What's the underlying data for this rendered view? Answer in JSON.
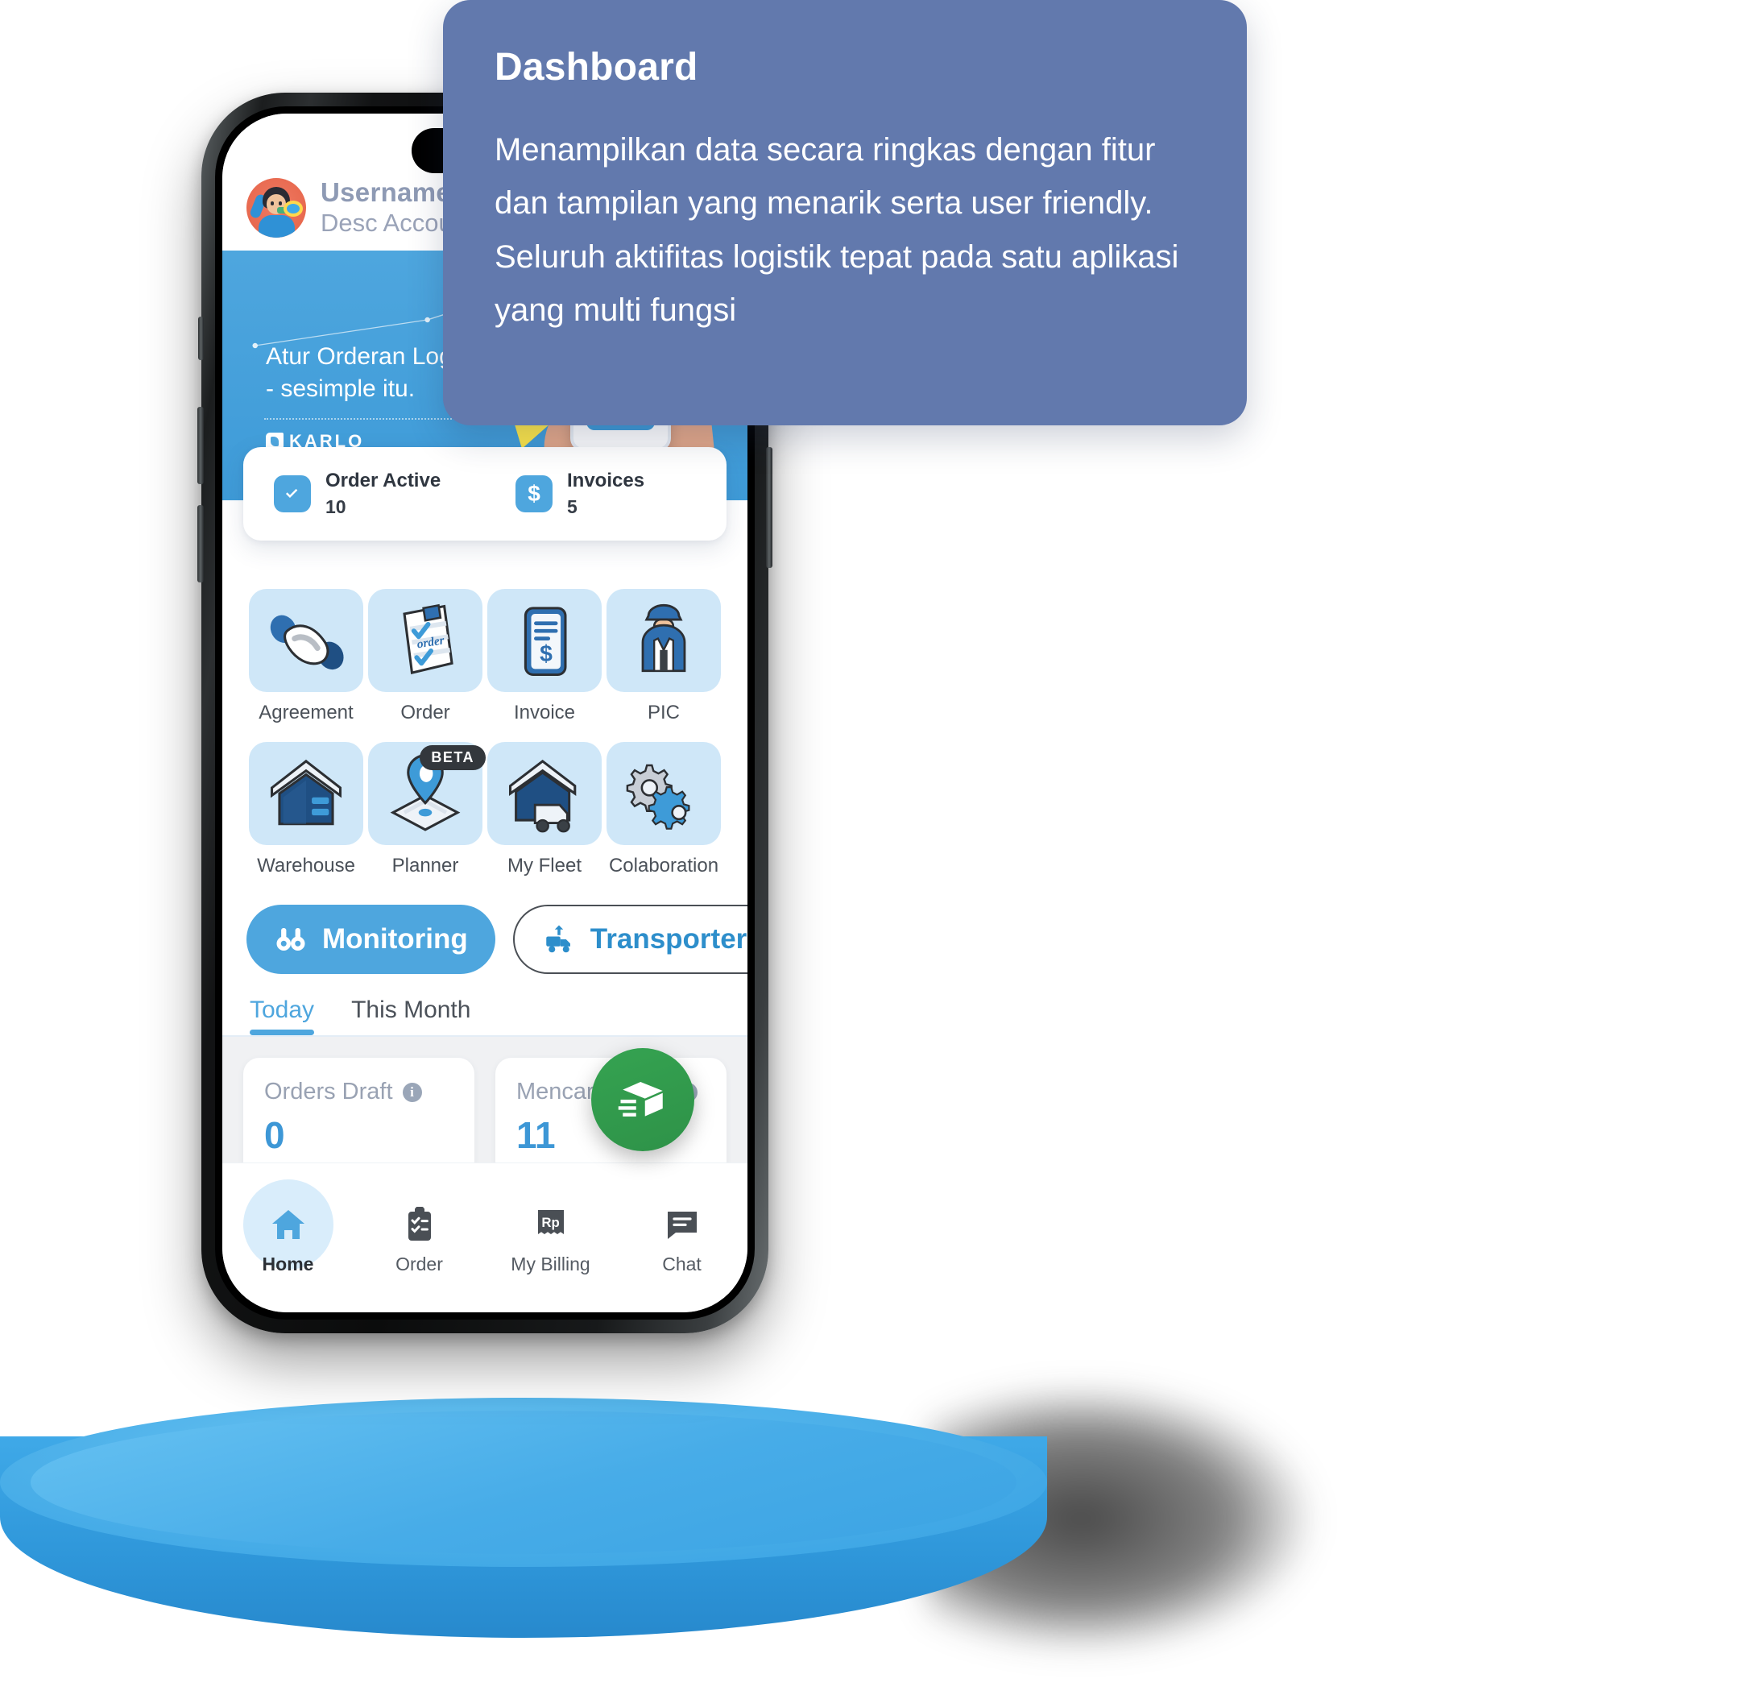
{
  "tooltip": {
    "title": "Dashboard",
    "body": "Menampilkan data secara ringkas dengan fitur dan tampilan yang menarik serta user friendly. Seluruh aktifitas logistik tepat pada satu aplikasi yang multi fungsi",
    "bg_color": "#6279ad"
  },
  "phone": {
    "header": {
      "username": "Username",
      "description": "Desc Account",
      "avatar_icon": "user-avatar-megaphone"
    },
    "banner": {
      "title_line1": "Atur Orderan Logistik",
      "title_line2": "- sesimple itu.",
      "brand": "KARLO"
    },
    "stats": [
      {
        "label": "Order Active",
        "value": "10",
        "icon": "check-square-icon"
      },
      {
        "label": "Invoices",
        "value": "5",
        "icon": "dollar-icon"
      }
    ],
    "menu": [
      {
        "label": "Agreement",
        "icon": "handshake-icon",
        "badge": ""
      },
      {
        "label": "Order",
        "icon": "order-clipboard-icon",
        "badge": ""
      },
      {
        "label": "Invoice",
        "icon": "invoice-phone-icon",
        "badge": ""
      },
      {
        "label": "PIC",
        "icon": "person-worker-icon",
        "badge": ""
      },
      {
        "label": "Warehouse",
        "icon": "warehouse-icon",
        "badge": ""
      },
      {
        "label": "Planner",
        "icon": "map-pin-icon",
        "badge": "BETA"
      },
      {
        "label": "My Fleet",
        "icon": "truck-icon",
        "badge": ""
      },
      {
        "label": "Colaboration",
        "icon": "gears-icon",
        "badge": ""
      }
    ],
    "actions": [
      {
        "label": "Monitoring",
        "icon": "binoculars-icon",
        "style": "primary"
      },
      {
        "label": "Transporter Performance",
        "icon": "truck-load-icon",
        "style": "outline"
      }
    ],
    "tabs": [
      {
        "label": "Today",
        "active": true
      },
      {
        "label": "This Month",
        "active": false
      }
    ],
    "metrics": [
      {
        "title": "Orders Draft",
        "value": "0",
        "has_info": true
      },
      {
        "title": "Mencari Driver",
        "value": "11",
        "has_info": true
      }
    ],
    "fab": {
      "icon": "shipping-box-icon",
      "color": "#35a351"
    },
    "bottom_nav": [
      {
        "label": "Home",
        "icon": "home-icon",
        "active": true
      },
      {
        "label": "Order",
        "icon": "clipboard-check-icon",
        "active": false
      },
      {
        "label": "My Billing",
        "icon": "rupiah-receipt-icon",
        "active": false
      },
      {
        "label": "Chat",
        "icon": "chat-bubble-icon",
        "active": false
      }
    ]
  },
  "podium": {
    "color": "#3fa9e8"
  }
}
